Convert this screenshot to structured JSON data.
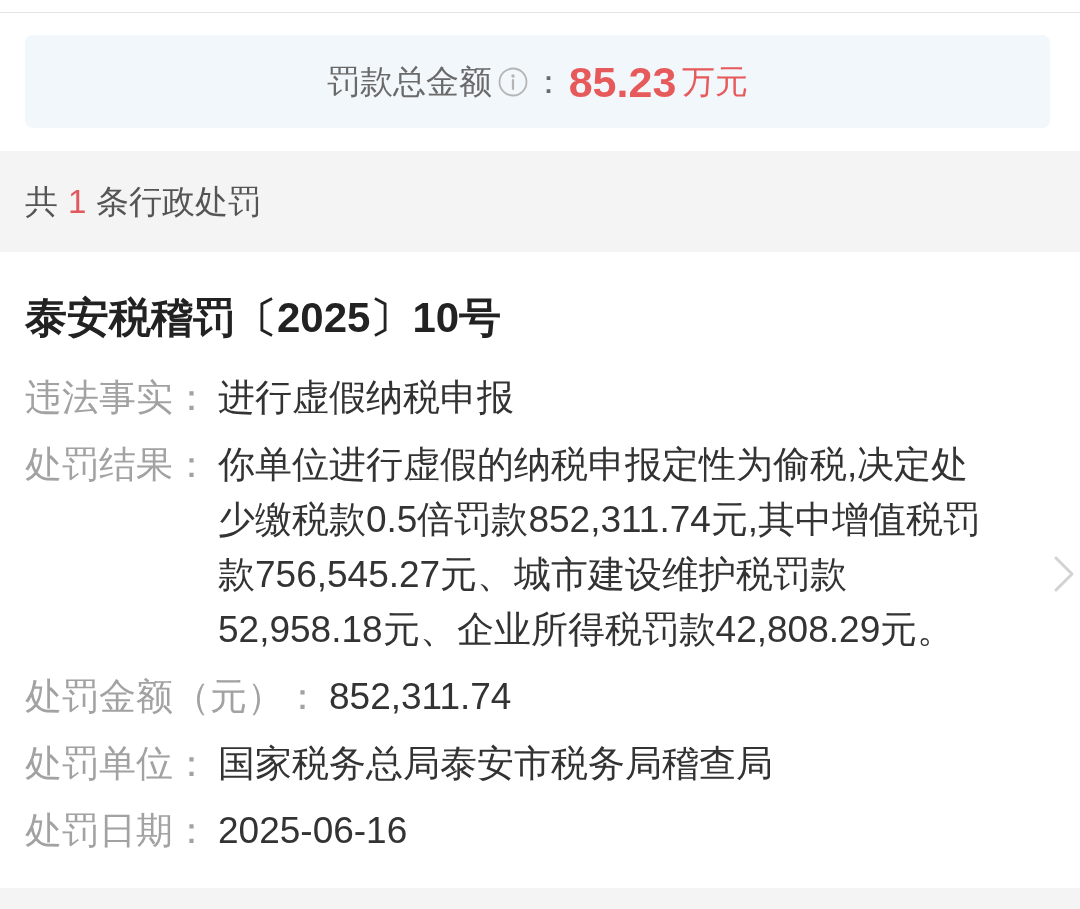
{
  "summary": {
    "label": "罚款总金额",
    "separator": "：",
    "amount": "85.23",
    "unit": "万元"
  },
  "list_header": {
    "prefix": "共",
    "count": "1",
    "suffix": "条行政处罚"
  },
  "records": [
    {
      "title": "泰安税稽罚〔2025〕10号",
      "fields": [
        {
          "label": "违法事实：",
          "value": "进行虚假纳税申报"
        },
        {
          "label": "处罚结果：",
          "value": "你单位进行虚假的纳税申报定性为偷税,决定处少缴税款0.5倍罚款852,311.74元,其中增值税罚款756,545.27元、城市建设维护税罚款52,958.18元、企业所得税罚款42,808.29元。"
        },
        {
          "label": "处罚金额（元）：",
          "value": "852,311.74"
        },
        {
          "label": "处罚单位：",
          "value": "国家税务总局泰安市税务局稽查局"
        },
        {
          "label": "处罚日期：",
          "value": "2025-06-16"
        }
      ]
    }
  ]
}
